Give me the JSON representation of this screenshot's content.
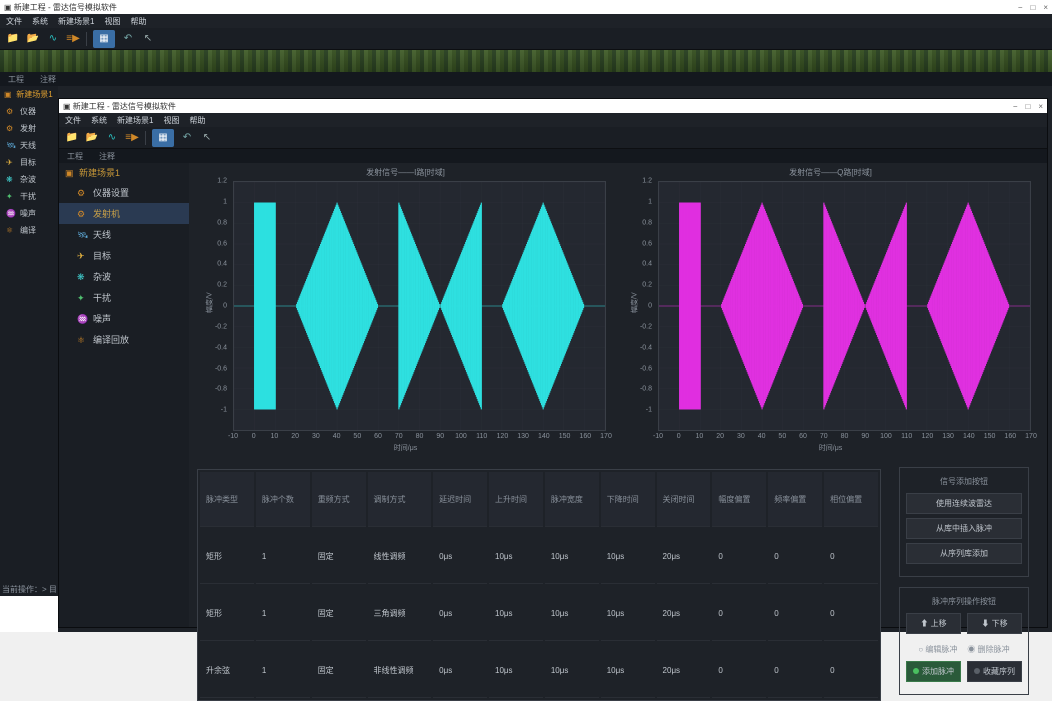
{
  "outer_window": {
    "title": "新建工程 - 雷达信号模拟软件",
    "controls": [
      "−",
      "□",
      "×"
    ]
  },
  "menubar": [
    "文件",
    "系统",
    "新建场景1",
    "视图",
    "帮助"
  ],
  "toolbar_icons": [
    "folder",
    "folder-open",
    "chart-wave",
    "play-lines",
    "grid-blue",
    "arrow-left",
    "cursor"
  ],
  "outer_panel_tabs": [
    "工程",
    "注释"
  ],
  "outer_tree": {
    "root": "新建场景1",
    "items": [
      {
        "icon": "instrument",
        "label": "仪器"
      },
      {
        "icon": "tx",
        "label": "发射"
      },
      {
        "icon": "antenna",
        "label": "天线"
      },
      {
        "icon": "target",
        "label": "目标"
      },
      {
        "icon": "clutter",
        "label": "杂波"
      },
      {
        "icon": "jam",
        "label": "干扰"
      },
      {
        "icon": "noise",
        "label": "噪声"
      },
      {
        "icon": "compile",
        "label": "编译"
      }
    ]
  },
  "status_bar": "当前操作：> 目标",
  "child_window": {
    "title": "新建工程 - 雷达信号模拟软件",
    "menubar": [
      "文件",
      "系统",
      "新建场景1",
      "视图",
      "帮助"
    ],
    "panel_tabs": [
      "工程",
      "注释"
    ],
    "tree": {
      "root": "新建场景1",
      "items": [
        {
          "icon": "instrument",
          "label": "仪器设置"
        },
        {
          "icon": "tx",
          "label": "发射机",
          "selected": true
        },
        {
          "icon": "antenna",
          "label": "天线"
        },
        {
          "icon": "target",
          "label": "目标"
        },
        {
          "icon": "clutter",
          "label": "杂波"
        },
        {
          "icon": "jam",
          "label": "干扰"
        },
        {
          "icon": "noise",
          "label": "噪声"
        },
        {
          "icon": "compile",
          "label": "编译回放"
        }
      ]
    }
  },
  "chart_data": [
    {
      "type": "line",
      "title": "发射信号——I路[时域]",
      "xlabel": "时间/μs",
      "ylabel": "幅度/V",
      "xlim": [
        -10,
        170
      ],
      "ylim": [
        -1.2,
        1.2
      ],
      "color": "#2ee0e0",
      "envelope": [
        {
          "x0": 0,
          "x1": 10,
          "amp": 1.0,
          "shape": "block"
        },
        {
          "x0": 20,
          "x1": 60,
          "amp": 1.0,
          "shape": "diamond"
        },
        {
          "x0": 70,
          "x1": 110,
          "amp": 1.0,
          "shape": "pinch"
        },
        {
          "x0": 120,
          "x1": 160,
          "amp": 1.0,
          "shape": "diamond"
        }
      ],
      "yticks": [
        -1.0,
        -0.8,
        -0.6,
        -0.4,
        -0.2,
        0,
        0.2,
        0.4,
        0.6,
        0.8,
        1.0,
        1.2
      ],
      "xticks": [
        -10,
        0,
        10,
        20,
        30,
        40,
        50,
        60,
        70,
        80,
        90,
        100,
        110,
        120,
        130,
        140,
        150,
        160,
        170
      ]
    },
    {
      "type": "line",
      "title": "发射信号——Q路[时域]",
      "xlabel": "时间/μs",
      "ylabel": "幅度/V",
      "xlim": [
        -10,
        170
      ],
      "ylim": [
        -1.2,
        1.2
      ],
      "color": "#e030e0",
      "envelope": [
        {
          "x0": 0,
          "x1": 10,
          "amp": 1.0,
          "shape": "block"
        },
        {
          "x0": 20,
          "x1": 60,
          "amp": 1.0,
          "shape": "diamond"
        },
        {
          "x0": 70,
          "x1": 110,
          "amp": 1.0,
          "shape": "pinch"
        },
        {
          "x0": 120,
          "x1": 160,
          "amp": 1.0,
          "shape": "diamond"
        }
      ],
      "yticks": [
        -1.0,
        -0.8,
        -0.6,
        -0.4,
        -0.2,
        0,
        0.2,
        0.4,
        0.6,
        0.8,
        1.0,
        1.2
      ],
      "xticks": [
        -10,
        0,
        10,
        20,
        30,
        40,
        50,
        60,
        70,
        80,
        90,
        100,
        110,
        120,
        130,
        140,
        150,
        160,
        170
      ]
    }
  ],
  "table": {
    "columns": [
      "脉冲类型",
      "脉冲个数",
      "重频方式",
      "调制方式",
      "延迟时间",
      "上升时间",
      "脉冲宽度",
      "下降时间",
      "关闭时间",
      "幅度偏置",
      "频率偏置",
      "相位偏置"
    ],
    "rows": [
      [
        "矩形",
        "1",
        "固定",
        "线性调频",
        "0μs",
        "10μs",
        "10μs",
        "10μs",
        "20μs",
        "0",
        "0",
        "0"
      ],
      [
        "矩形",
        "1",
        "固定",
        "三角调频",
        "0μs",
        "10μs",
        "10μs",
        "10μs",
        "20μs",
        "0",
        "0",
        "0"
      ],
      [
        "升余弦",
        "1",
        "固定",
        "非线性调频",
        "0μs",
        "10μs",
        "10μs",
        "10μs",
        "20μs",
        "0",
        "0",
        "0"
      ]
    ]
  },
  "btn_panels": {
    "add": {
      "title": "信号添加按钮",
      "buttons": [
        "使用连续波雷达",
        "从库中插入脉冲",
        "从序列库添加"
      ]
    },
    "seq": {
      "title": "脉冲序列操作按钮",
      "move": [
        "上移",
        "下移"
      ],
      "radio": [
        "编辑脉冲",
        "删除脉冲"
      ],
      "radio_selected": 1,
      "actions": [
        "添加脉冲",
        "收藏序列"
      ]
    }
  }
}
